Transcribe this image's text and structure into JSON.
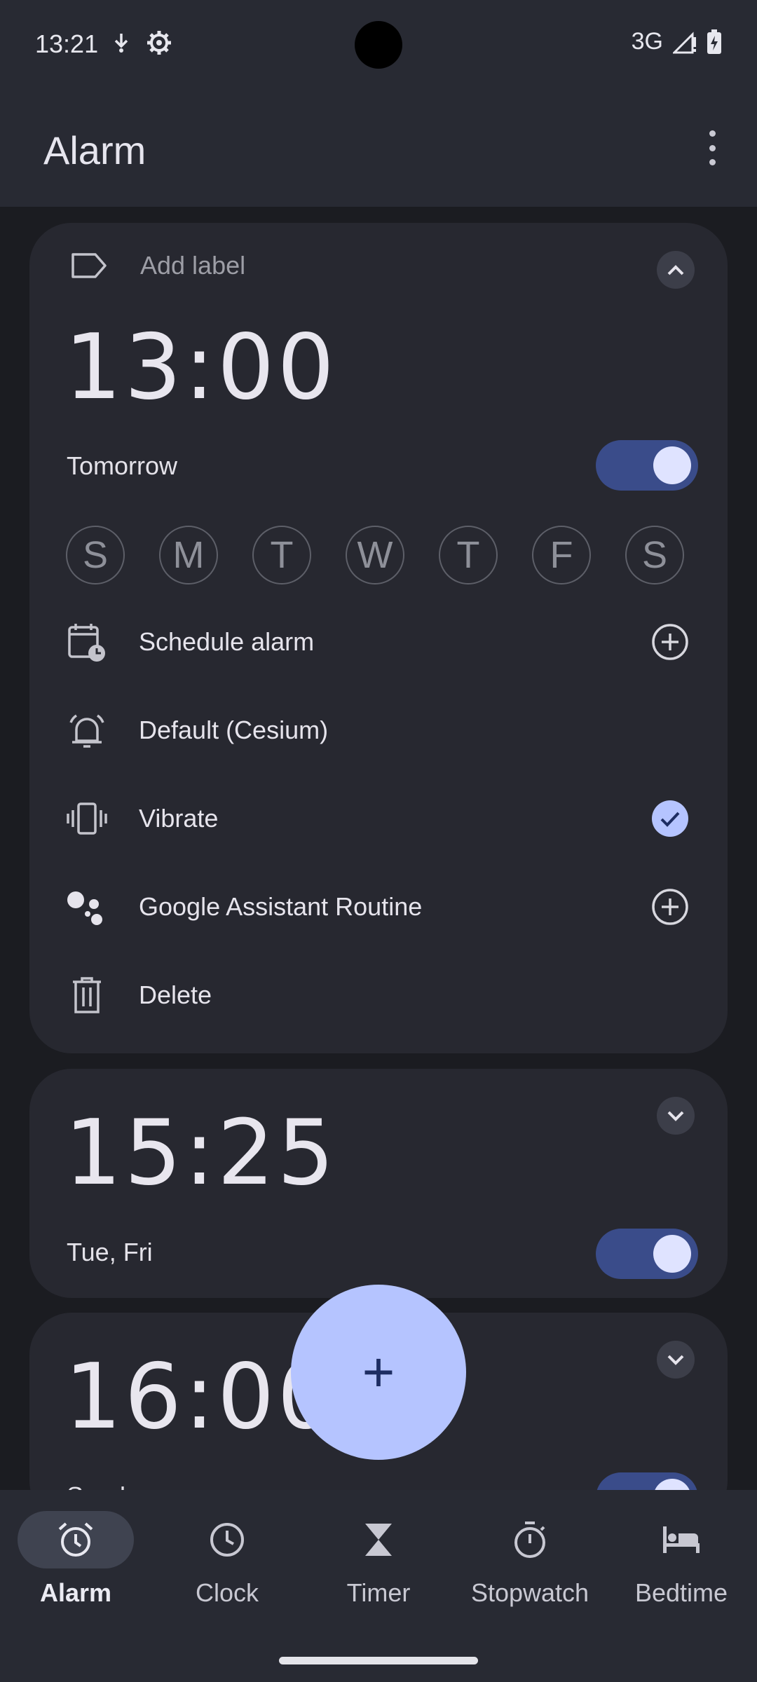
{
  "status": {
    "time": "13:21",
    "network": "3G"
  },
  "app_bar": {
    "title": "Alarm"
  },
  "alarms": [
    {
      "label_placeholder": "Add label",
      "time": "13:00",
      "subtitle": "Tomorrow",
      "enabled": true,
      "expanded": true,
      "days": [
        "S",
        "M",
        "T",
        "W",
        "T",
        "F",
        "S"
      ],
      "options": {
        "schedule": "Schedule alarm",
        "sound": "Default (Cesium)",
        "vibrate": "Vibrate",
        "vibrate_checked": true,
        "assistant": "Google Assistant Routine",
        "delete": "Delete"
      }
    },
    {
      "time": "15:25",
      "subtitle": "Tue, Fri",
      "enabled": true,
      "expanded": false
    },
    {
      "time": "16:00",
      "subtitle": "Sunday",
      "enabled": true,
      "expanded": false
    }
  ],
  "fab": {
    "icon": "+"
  },
  "nav": [
    {
      "label": "Alarm",
      "icon": "alarm-icon",
      "active": true
    },
    {
      "label": "Clock",
      "icon": "clock-icon",
      "active": false
    },
    {
      "label": "Timer",
      "icon": "hourglass-icon",
      "active": false
    },
    {
      "label": "Stopwatch",
      "icon": "stopwatch-icon",
      "active": false
    },
    {
      "label": "Bedtime",
      "icon": "bed-icon",
      "active": false
    }
  ],
  "colors": {
    "accent": "#b5c4ff",
    "toggle_track": "#3a4c8a",
    "card": "#272830",
    "background": "#1b1c21"
  }
}
